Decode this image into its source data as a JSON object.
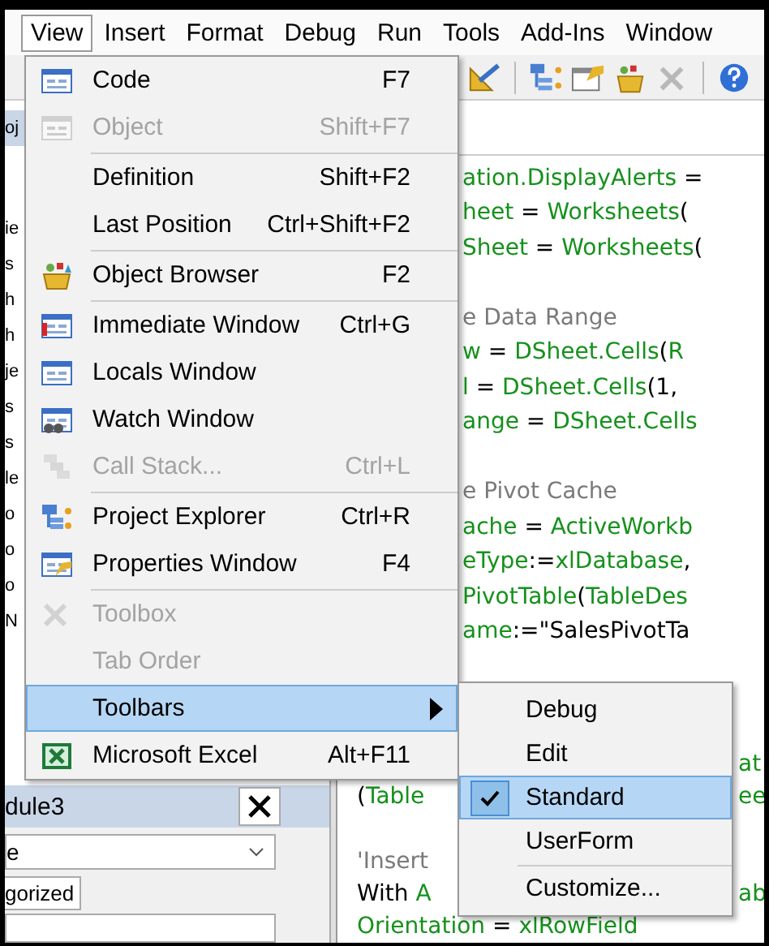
{
  "menu_bar": [
    {
      "label": "View",
      "selected": true
    },
    {
      "label": "Insert",
      "selected": false
    },
    {
      "label": "Format",
      "selected": false
    },
    {
      "label": "Debug",
      "selected": false
    },
    {
      "label": "Run",
      "selected": false
    },
    {
      "label": "Tools",
      "selected": false
    },
    {
      "label": "Add-Ins",
      "selected": false
    },
    {
      "label": "Window",
      "selected": false
    }
  ],
  "project_explorer": {
    "header": "oj",
    "rows": [
      "ie",
      "s",
      "h",
      "h",
      "je",
      "s",
      "s",
      "le",
      "o",
      "o",
      "o",
      "N"
    ]
  },
  "properties_panel": {
    "title": "dule3",
    "dropdown_value": "e",
    "tabs": [
      {
        "label": "gorized",
        "selected": true
      }
    ]
  },
  "code_top": [
    {
      "middle": [
        {
          "kind": "name",
          "text": "ation.DisplayAlerts"
        },
        {
          "kind": "plain",
          "text": " ="
        }
      ]
    },
    {
      "middle": [
        {
          "kind": "name",
          "text": "heet"
        },
        {
          "kind": "plain",
          "text": " = "
        },
        {
          "kind": "name",
          "text": "Worksheets"
        },
        {
          "kind": "plain",
          "text": "("
        }
      ]
    },
    {
      "middle": [
        {
          "kind": "name",
          "text": "Sheet"
        },
        {
          "kind": "plain",
          "text": " = "
        },
        {
          "kind": "name",
          "text": "Worksheets"
        },
        {
          "kind": "plain",
          "text": "("
        }
      ]
    },
    {
      "blank_before": true,
      "middle": [
        {
          "kind": "comment",
          "text": "e Data Range"
        }
      ]
    },
    {
      "middle": [
        {
          "kind": "name",
          "text": "w"
        },
        {
          "kind": "plain",
          "text": " = "
        },
        {
          "kind": "name",
          "text": "DSheet.Cells"
        },
        {
          "kind": "plain",
          "text": "("
        },
        {
          "kind": "name",
          "text": "R"
        }
      ]
    },
    {
      "middle": [
        {
          "kind": "name",
          "text": "l"
        },
        {
          "kind": "plain",
          "text": " = "
        },
        {
          "kind": "name",
          "text": "DSheet.Cells"
        },
        {
          "kind": "plain",
          "text": "(1,"
        }
      ]
    },
    {
      "middle": [
        {
          "kind": "name",
          "text": "ange"
        },
        {
          "kind": "plain",
          "text": " = "
        },
        {
          "kind": "name",
          "text": "DSheet.Cells"
        }
      ]
    },
    {
      "blank_before": true,
      "middle": [
        {
          "kind": "comment",
          "text": "e Pivot Cache"
        }
      ]
    },
    {
      "middle": [
        {
          "kind": "name",
          "text": "ache"
        },
        {
          "kind": "plain",
          "text": " = "
        },
        {
          "kind": "name",
          "text": "ActiveWorkb"
        }
      ]
    },
    {
      "middle": [
        {
          "kind": "name",
          "text": "eType"
        },
        {
          "kind": "plain",
          "text": ":="
        },
        {
          "kind": "name",
          "text": "xlDatabase"
        },
        {
          "kind": "plain",
          "text": ","
        }
      ]
    },
    {
      "middle": [
        {
          "kind": "name",
          "text": "PivotTable"
        },
        {
          "kind": "plain",
          "text": "("
        },
        {
          "kind": "name",
          "text": "TableDes"
        }
      ]
    },
    {
      "middle": [
        {
          "kind": "name",
          "text": "ame"
        },
        {
          "kind": "plain",
          "text": ":=\"SalesPivotTa"
        }
      ]
    }
  ],
  "code_bottom": [
    {
      "right": [
        {
          "kind": "name",
          "text": "at"
        }
      ]
    },
    {
      "left": [
        {
          "kind": "plain",
          "text": "("
        },
        {
          "kind": "name",
          "text": "Table"
        }
      ],
      "right": [
        {
          "kind": "name",
          "text": "ee"
        }
      ]
    },
    {
      "blank_before": true,
      "left": [
        {
          "kind": "comment",
          "text": "'Insert"
        }
      ]
    },
    {
      "left": [
        {
          "kind": "plain",
          "text": "With "
        },
        {
          "kind": "name",
          "text": "A"
        }
      ],
      "right": [
        {
          "kind": "name",
          "text": "ab"
        }
      ]
    },
    {
      "left": [
        {
          "kind": "name",
          "text": "Orientation"
        },
        {
          "kind": "plain",
          "text": " = "
        },
        {
          "kind": "name",
          "text": "xlRowField"
        }
      ]
    }
  ],
  "view_menu": [
    {
      "kind": "item",
      "label": "Code",
      "shortcut": "F7",
      "disabled": false,
      "selected": false
    },
    {
      "kind": "item",
      "label": "Object",
      "shortcut": "Shift+F7",
      "disabled": true,
      "selected": false
    },
    {
      "kind": "separator"
    },
    {
      "kind": "item",
      "label": "Definition",
      "shortcut": "Shift+F2",
      "disabled": false,
      "selected": false
    },
    {
      "kind": "item",
      "label": "Last Position",
      "shortcut": "Ctrl+Shift+F2",
      "disabled": false,
      "selected": false
    },
    {
      "kind": "separator"
    },
    {
      "kind": "item",
      "label": "Object Browser",
      "shortcut": "F2",
      "disabled": false,
      "selected": false
    },
    {
      "kind": "separator"
    },
    {
      "kind": "item",
      "label": "Immediate Window",
      "shortcut": "Ctrl+G",
      "disabled": false,
      "selected": false
    },
    {
      "kind": "item",
      "label": "Locals Window",
      "disabled": false,
      "selected": false
    },
    {
      "kind": "item",
      "label": "Watch Window",
      "disabled": false,
      "selected": false
    },
    {
      "kind": "item",
      "label": "Call Stack...",
      "shortcut": "Ctrl+L",
      "disabled": true,
      "selected": false
    },
    {
      "kind": "separator"
    },
    {
      "kind": "item",
      "label": "Project Explorer",
      "shortcut": "Ctrl+R",
      "disabled": false,
      "selected": false
    },
    {
      "kind": "item",
      "label": "Properties Window",
      "shortcut": "F4",
      "disabled": false,
      "selected": false
    },
    {
      "kind": "separator"
    },
    {
      "kind": "item",
      "label": "Toolbox",
      "disabled": true,
      "selected": false
    },
    {
      "kind": "item",
      "label": "Tab Order",
      "disabled": true,
      "selected": false
    },
    {
      "kind": "submenu",
      "label": "Toolbars",
      "disabled": false,
      "selected": true
    },
    {
      "kind": "item",
      "label": "Microsoft Excel",
      "shortcut": "Alt+F11",
      "disabled": false,
      "selected": false
    }
  ],
  "toolbars_submenu": [
    {
      "kind": "item",
      "label": "Debug",
      "checked": false,
      "selected": false
    },
    {
      "kind": "item",
      "label": "Edit",
      "checked": false,
      "selected": false
    },
    {
      "kind": "item",
      "label": "Standard",
      "checked": true,
      "selected": true
    },
    {
      "kind": "item",
      "label": "UserForm",
      "checked": false,
      "selected": false
    },
    {
      "kind": "separator"
    },
    {
      "kind": "item",
      "label": "Customize...",
      "checked": false,
      "selected": false
    }
  ]
}
